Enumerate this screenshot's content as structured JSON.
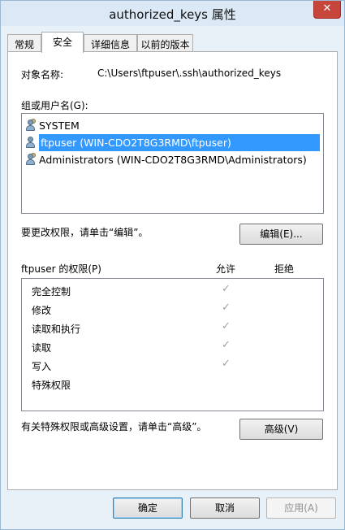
{
  "window": {
    "title": "authorized_keys 属性",
    "close_icon": "close-icon"
  },
  "tabs": [
    {
      "label": "常规",
      "active": false
    },
    {
      "label": "安全",
      "active": true
    },
    {
      "label": "详细信息",
      "active": false
    },
    {
      "label": "以前的版本",
      "active": false
    }
  ],
  "security": {
    "object_name_label": "对象名称:",
    "object_name_value": "C:\\Users\\ftpuser\\.ssh\\authorized_keys",
    "group_label": "组或用户名(G):",
    "users": [
      {
        "name": "SYSTEM",
        "icon": "users-group-icon",
        "selected": false
      },
      {
        "name": "ftpuser (WIN-CDO2T8G3RMD\\ftpuser)",
        "icon": "user-icon",
        "selected": true
      },
      {
        "name": "Administrators (WIN-CDO2T8G3RMD\\Administrators)",
        "icon": "users-group-icon",
        "selected": false
      }
    ],
    "change_hint": "要更改权限，请单击“编辑”。",
    "edit_button": "编辑(E)...",
    "permissions_label": "ftpuser 的权限(P)",
    "allow_header": "允许",
    "deny_header": "拒绝",
    "permissions": [
      {
        "name": "完全控制",
        "allow": true,
        "deny": false
      },
      {
        "name": "修改",
        "allow": true,
        "deny": false
      },
      {
        "name": "读取和执行",
        "allow": true,
        "deny": false
      },
      {
        "name": "读取",
        "allow": true,
        "deny": false
      },
      {
        "name": "写入",
        "allow": true,
        "deny": false
      },
      {
        "name": "特殊权限",
        "allow": false,
        "deny": false
      }
    ],
    "check_mark": "✓",
    "advanced_hint": "有关特殊权限或高级设置，请单击“高级”。",
    "advanced_button": "高级(V)"
  },
  "footer": {
    "ok": "确定",
    "cancel": "取消",
    "apply": "应用(A)"
  }
}
